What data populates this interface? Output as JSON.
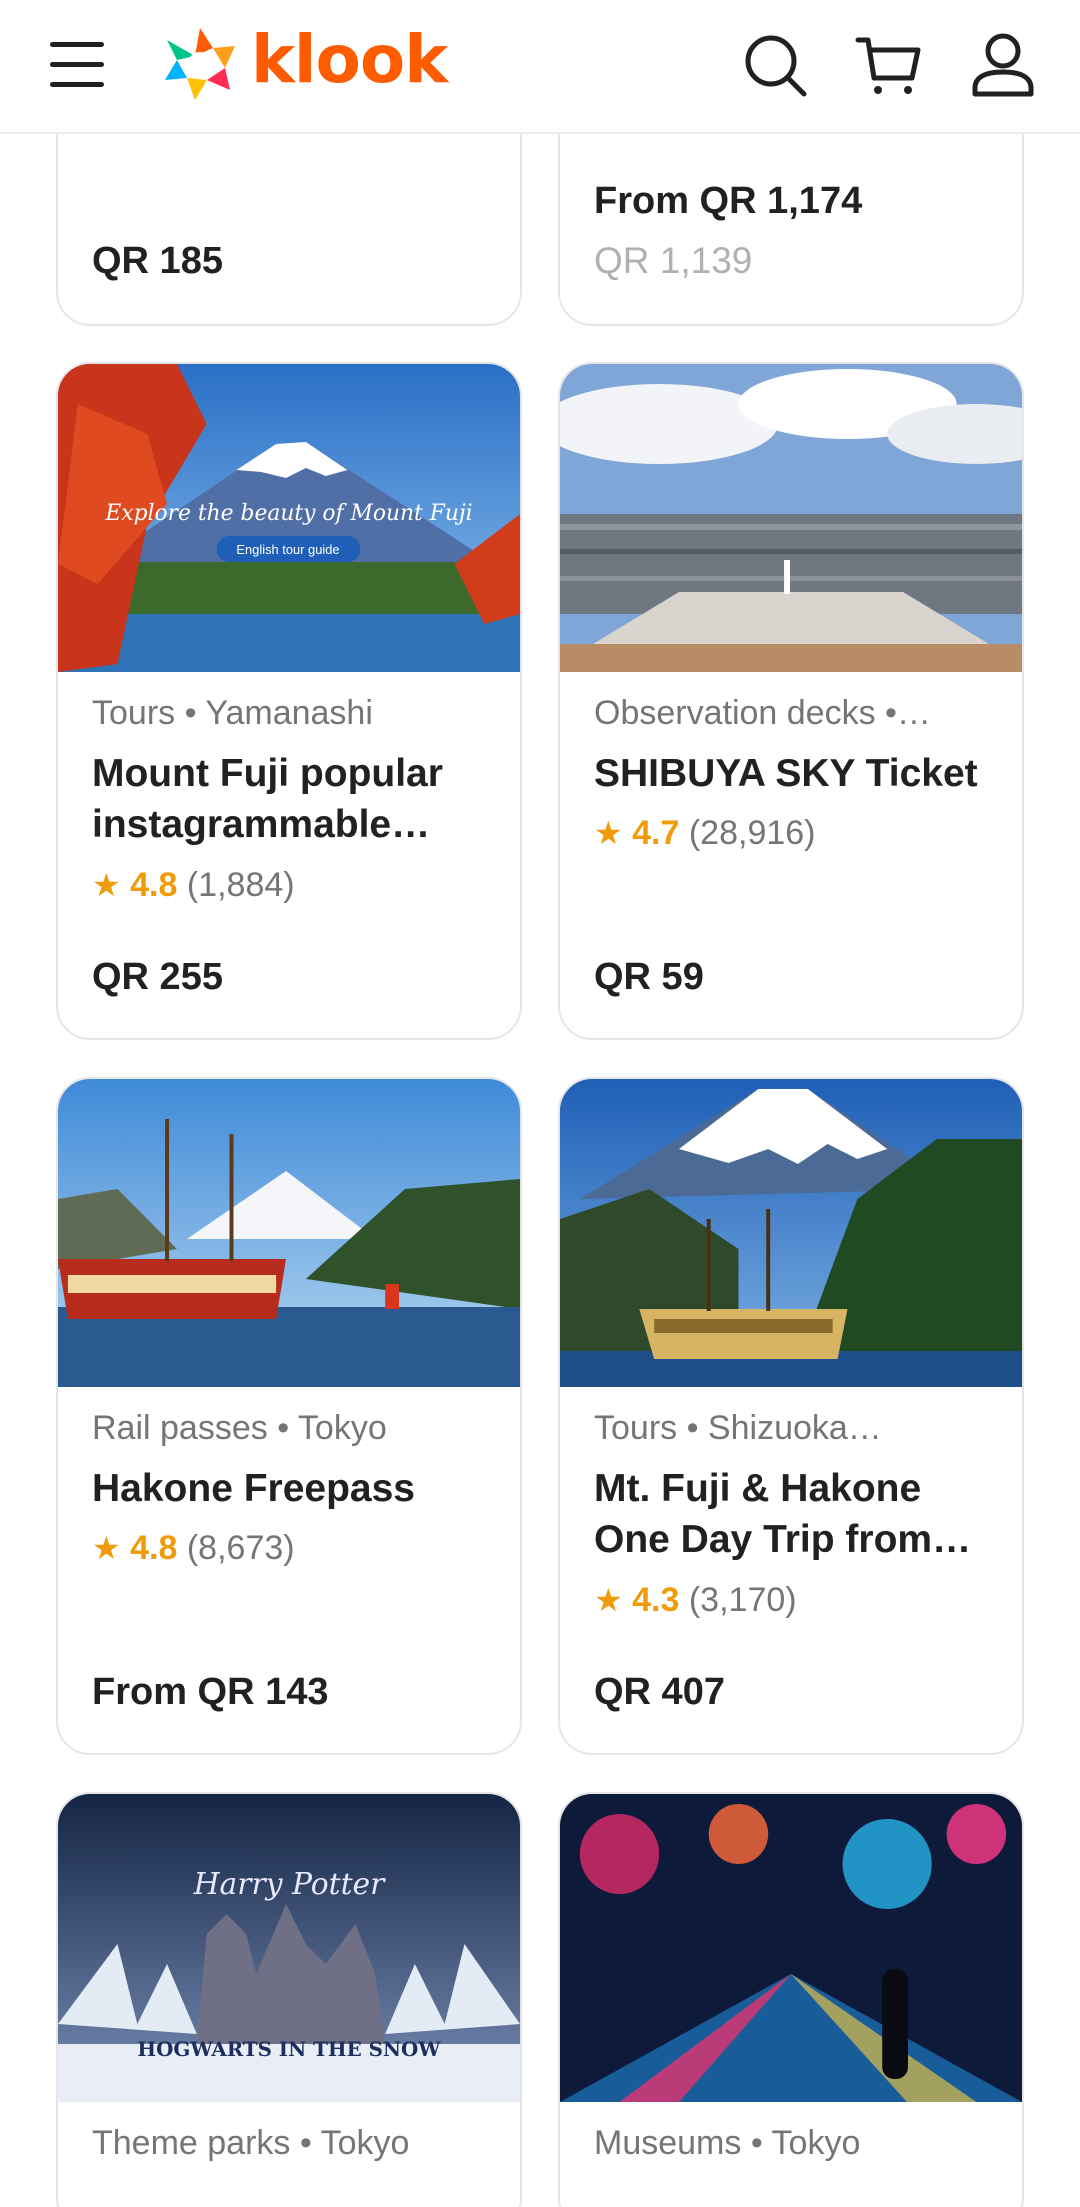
{
  "header": {
    "brand": "klook",
    "menu_icon": "hamburger-menu-icon",
    "search_icon": "search-icon",
    "cart_icon": "cart-icon",
    "account_icon": "user-icon"
  },
  "colors": {
    "brand": "#ff5b00",
    "rating": "#f09b0a",
    "price_muted": "#b0b0b0"
  },
  "cards": [
    {
      "price": "QR 185"
    },
    {
      "price": "From QR 1,174",
      "old_price": "QR 1,139"
    },
    {
      "category": "Tours • Yamanashi",
      "title": "Mount Fuji popular instagrammable…",
      "rating_star": "★",
      "rating": "4.8",
      "reviews": "(1,884)",
      "price": "QR 255",
      "image": "mount-fuji-autumn-image",
      "image_overlay": "Explore the beauty of Mount Fuji",
      "image_tag": "English tour guide"
    },
    {
      "category": "Observation decks •…",
      "title": "SHIBUYA SKY Ticket",
      "rating_star": "★",
      "rating": "4.7",
      "reviews": "(28,916)",
      "price": "QR 59",
      "image": "shibuya-sky-rooftop-image"
    },
    {
      "category": "Rail passes • Tokyo",
      "title": "Hakone Freepass",
      "rating_star": "★",
      "rating": "4.8",
      "reviews": "(8,673)",
      "price": "From QR 143",
      "image": "hakone-pirate-ship-image"
    },
    {
      "category": "Tours • Shizuoka…",
      "title": "Mt. Fuji & Hakone One Day Trip from…",
      "rating_star": "★",
      "rating": "4.3",
      "reviews": "(3,170)",
      "price": "QR 407",
      "image": "fuji-hakone-cruise-image"
    },
    {
      "category": "Theme parks • Tokyo",
      "image": "harry-potter-hogwarts-snow-image",
      "image_text_1": "Harry Potter",
      "image_text_2": "HOGWARTS IN THE SNOW"
    },
    {
      "category": "Museums • Tokyo",
      "image": "digital-art-museum-image"
    }
  ]
}
